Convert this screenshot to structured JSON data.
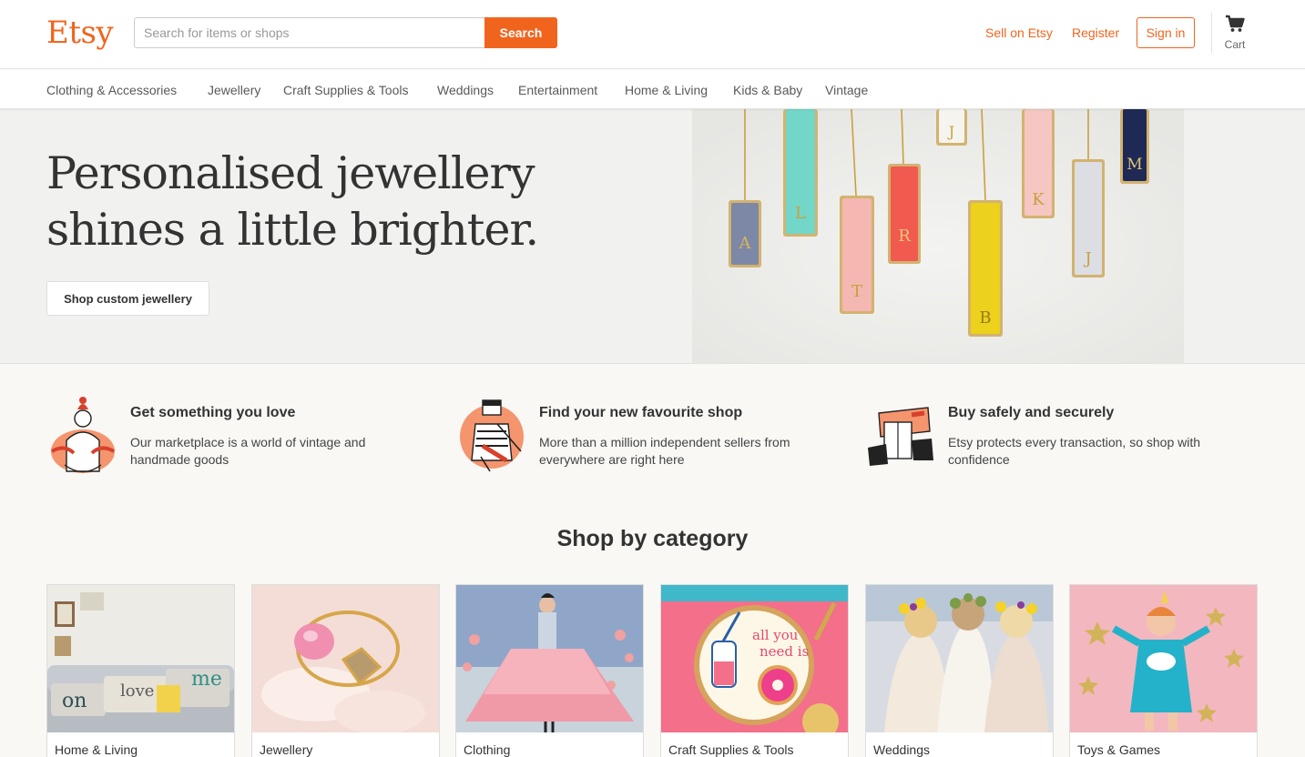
{
  "header": {
    "logo": "Etsy",
    "search_placeholder": "Search for items or shops",
    "search_button": "Search",
    "sell_link": "Sell on Etsy",
    "register_link": "Register",
    "signin_button": "Sign in",
    "cart_label": "Cart",
    "cart_icon": "cart-icon",
    "accent_color": "#f1641e"
  },
  "nav": {
    "items": [
      {
        "label": "Clothing & Accessories"
      },
      {
        "label": "Jewellery"
      },
      {
        "label": "Craft Supplies & Tools"
      },
      {
        "label": "Weddings"
      },
      {
        "label": "Entertainment"
      },
      {
        "label": "Home & Living"
      },
      {
        "label": "Kids & Baby"
      },
      {
        "label": "Vintage"
      }
    ]
  },
  "hero": {
    "title": "Personalised jewellery shines a little brighter.",
    "button": "Shop custom jewellery",
    "pendant_letters": [
      "A",
      "L",
      "T",
      "R",
      "J",
      "B",
      "K",
      "J",
      "M"
    ]
  },
  "value_props": [
    {
      "title": "Get something you love",
      "description": "Our marketplace is a world of vintage and handmade goods",
      "icon": "person-hugging-icon"
    },
    {
      "title": "Find your new favourite shop",
      "description": "More than a million independent sellers from everywhere are right here",
      "icon": "seller-crafting-icon"
    },
    {
      "title": "Buy safely and securely",
      "description": "Etsy protects every transaction, so shop with confidence",
      "icon": "handing-package-icon"
    }
  ],
  "categories": {
    "heading": "Shop by category",
    "items": [
      {
        "label": "Home & Living"
      },
      {
        "label": "Jewellery"
      },
      {
        "label": "Clothing"
      },
      {
        "label": "Craft Supplies & Tools"
      },
      {
        "label": "Weddings"
      },
      {
        "label": "Toys & Games"
      }
    ]
  }
}
